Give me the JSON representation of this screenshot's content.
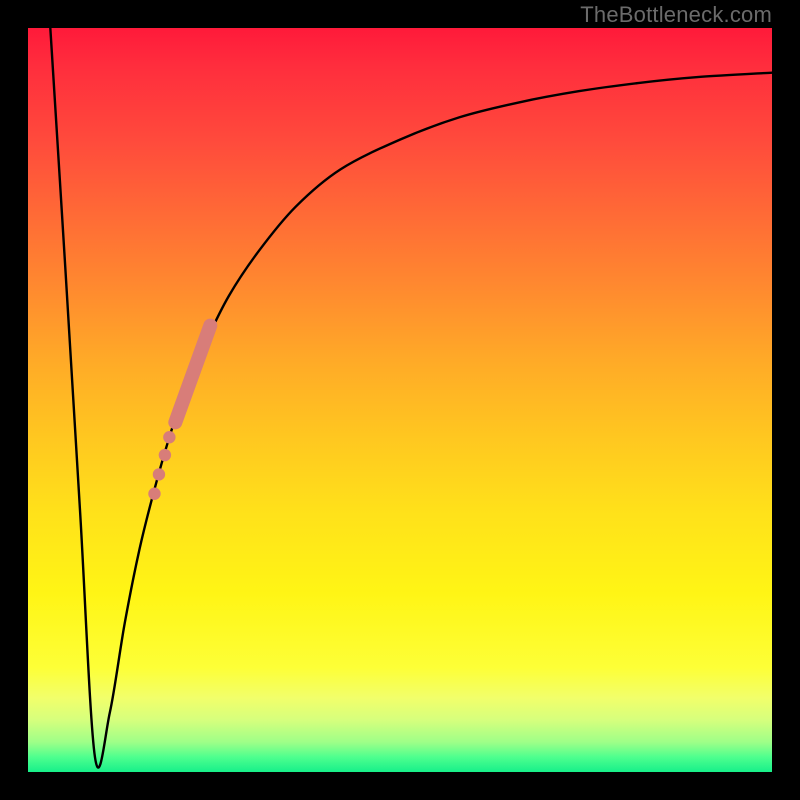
{
  "watermark": "TheBottleneck.com",
  "colors": {
    "curve": "#000000",
    "overlay": "#d87d79",
    "frame": "#000000"
  },
  "chart_data": {
    "type": "line",
    "title": "",
    "xlabel": "",
    "ylabel": "",
    "xlim": [
      0,
      100
    ],
    "ylim": [
      0,
      100
    ],
    "grid": false,
    "notes": "Bottleneck curve: steep drop from near 100 at x≈3 to ~2 at x≈9, then asymptotic rise toward ~94 as x→100. Salmon overlay band and dots highlight a segment on the rising branch around x≈18–24.",
    "series": [
      {
        "name": "bottleneck-curve",
        "x": [
          3,
          5,
          7,
          9,
          11,
          13,
          15,
          17,
          19,
          21,
          24,
          27,
          31,
          36,
          42,
          50,
          58,
          66,
          74,
          82,
          90,
          100
        ],
        "y": [
          100,
          68,
          35,
          2,
          8,
          20,
          30,
          38,
          45,
          51,
          58,
          64,
          70,
          76,
          81,
          85,
          88,
          90,
          91.5,
          92.6,
          93.4,
          94
        ]
      }
    ],
    "overlay": {
      "band": {
        "x": [
          19.8,
          24.5
        ],
        "y": [
          47,
          60
        ]
      },
      "dots": [
        {
          "x": 19.0,
          "y": 45
        },
        {
          "x": 18.4,
          "y": 42.6
        },
        {
          "x": 17.6,
          "y": 40
        },
        {
          "x": 17.0,
          "y": 37.4
        }
      ]
    }
  }
}
